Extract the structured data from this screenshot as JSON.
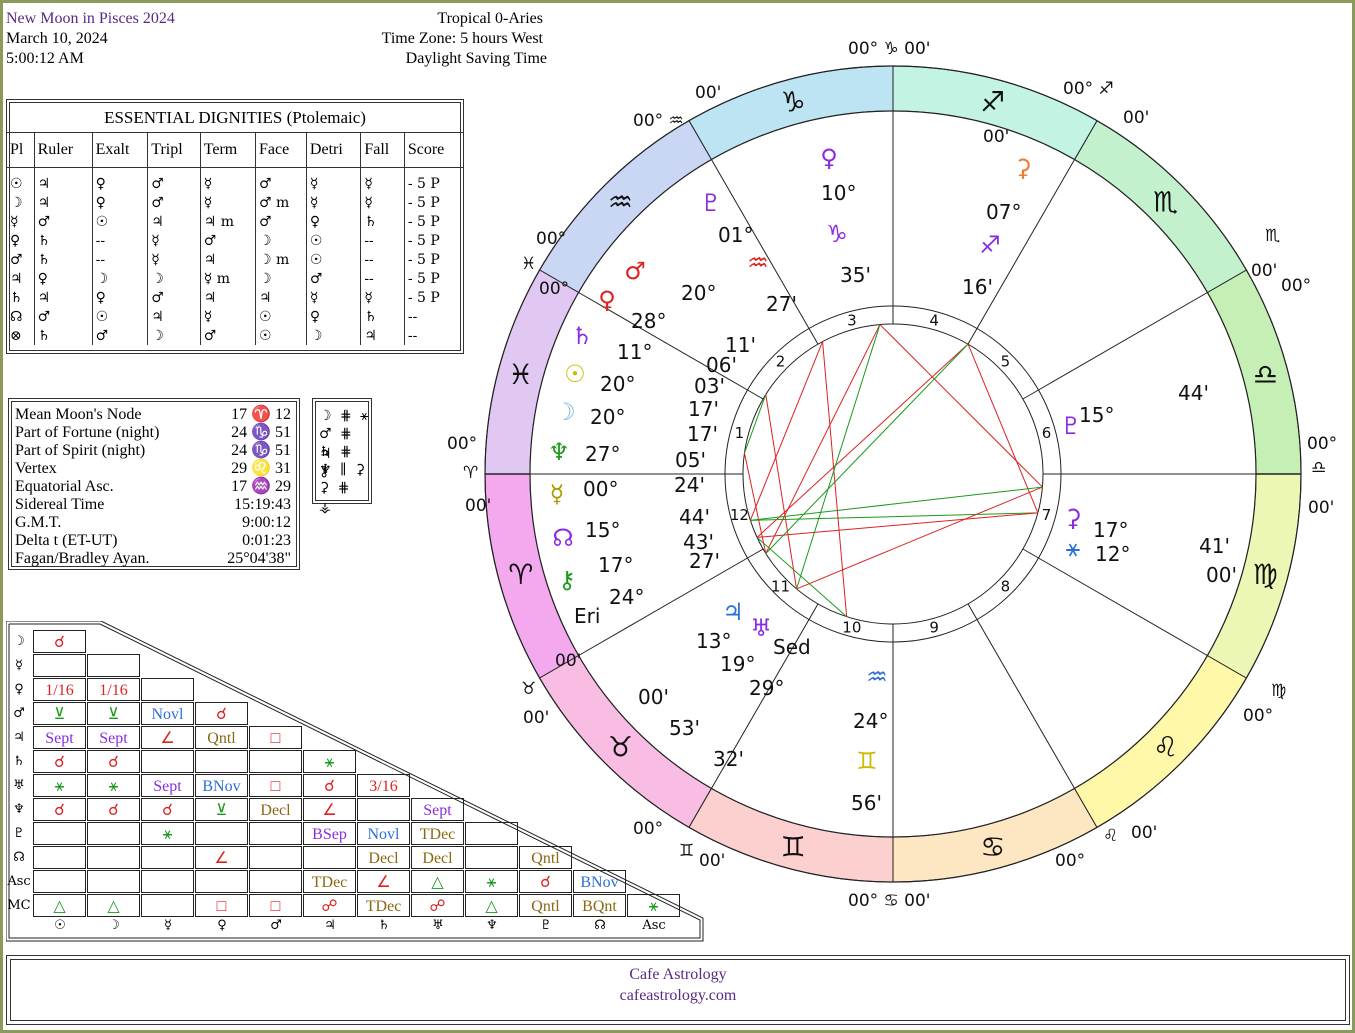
{
  "header": {
    "title": "New Moon in Pisces 2024",
    "date": "March 10, 2024",
    "time": "5:00:12 AM",
    "zodiac": "Tropical 0-Aries",
    "timezone": "Time Zone: 5 hours West",
    "dst": "Daylight Saving Time"
  },
  "dignities": {
    "caption": "ESSENTIAL DIGNITIES  (Ptolemaic)",
    "columns": [
      "Pl",
      "Ruler",
      "Exalt",
      "Tripl",
      "Term",
      "Face",
      "Detri",
      "Fall",
      "Score"
    ],
    "rows": [
      [
        "☉",
        "♃",
        "♀",
        "♂",
        "☿",
        "♂",
        "☿",
        "☿",
        "- 5 P"
      ],
      [
        "☽",
        "♃",
        "♀",
        "♂",
        "☿",
        "♂  m",
        "☿",
        "☿",
        "- 5 P"
      ],
      [
        "☿",
        "♂",
        "☉",
        "♃",
        "♃  m",
        "♂",
        "♀",
        "♄",
        "- 5 P"
      ],
      [
        "♀",
        "♄",
        "--",
        "☿",
        "♂",
        "☽",
        "☉",
        "--",
        "- 5 P"
      ],
      [
        "♂",
        "♄",
        "--",
        "☿",
        "♃",
        "☽  m",
        "☉",
        "--",
        "- 5 P"
      ],
      [
        "♃",
        "♀",
        "☽",
        "☽",
        "☿  m",
        "☽",
        "♂",
        "--",
        "- 5 P"
      ],
      [
        "♄",
        "♃",
        "♀",
        "♂",
        "♃",
        "♃",
        "☿",
        "☿",
        "- 5 P"
      ],
      [
        "☊",
        "♂",
        "☉",
        "♃",
        "☿",
        "☉",
        "♀",
        "♄",
        "--"
      ],
      [
        "⊗",
        "♄",
        "♂",
        "☽",
        "♂",
        "☉",
        "☽",
        "♃",
        "--"
      ]
    ]
  },
  "points": [
    {
      "label": "Mean Moon's Node",
      "value": "17 ♈ 12"
    },
    {
      "label": "Part of Fortune (night)",
      "value": "24 ♑ 51"
    },
    {
      "label": "Part of Spirit (night)",
      "value": "24 ♑ 51"
    },
    {
      "label": "Vertex",
      "value": "29 ♌ 31"
    },
    {
      "label": "Equatorial Asc.",
      "value": "17 ♒ 29"
    },
    {
      "label": "Sidereal Time",
      "value": "15:19:43"
    },
    {
      "label": "G.M.T.",
      "value": "9:00:12"
    },
    {
      "label": "Delta t (ET-UT)",
      "value": "0:01:23"
    },
    {
      "label": "Fagan/Bradley Ayan.",
      "value": "25°04'38\""
    }
  ],
  "mini_aspects": [
    "☽ ⋕ ⚹",
    "♂ ⋕ ♃",
    "♄ ⋕ ⚷",
    "♆ ∥ ⚳",
    "⚳ ⋕ ⚶"
  ],
  "aspect_grid": {
    "row_labels": [
      "☽",
      "☿",
      "♀",
      "♂",
      "♃",
      "♄",
      "♅",
      "♆",
      "♇",
      "☊",
      "Asc",
      "MC"
    ],
    "col_labels": [
      "☉",
      "☽",
      "☿",
      "♀",
      "♂",
      "♃",
      "♄",
      "♅",
      "♆",
      "♇",
      "☊",
      "Asc"
    ],
    "rows": [
      [
        {
          "t": "☌",
          "c": "#d22"
        }
      ],
      [
        {
          "t": "",
          "c": "#000"
        },
        {
          "t": "",
          "c": "#000"
        }
      ],
      [
        {
          "t": "1/16",
          "c": "#d22"
        },
        {
          "t": "1/16",
          "c": "#d22"
        },
        {
          "t": "",
          "c": "#000"
        }
      ],
      [
        {
          "t": "⊻",
          "c": "#1a9a1a"
        },
        {
          "t": "⊻",
          "c": "#1a9a1a"
        },
        {
          "t": "Novl",
          "c": "#2b6fd6"
        },
        {
          "t": "☌",
          "c": "#d22"
        }
      ],
      [
        {
          "t": "Sept",
          "c": "#8a2be2"
        },
        {
          "t": "Sept",
          "c": "#8a2be2"
        },
        {
          "t": "∠",
          "c": "#d22"
        },
        {
          "t": "Qntl",
          "c": "#8b6914"
        },
        {
          "t": "□",
          "c": "#d22"
        }
      ],
      [
        {
          "t": "☌",
          "c": "#d22"
        },
        {
          "t": "☌",
          "c": "#d22"
        },
        {
          "t": "",
          "c": "#000"
        },
        {
          "t": "",
          "c": "#000"
        },
        {
          "t": "",
          "c": "#000"
        },
        {
          "t": "⚹",
          "c": "#1a9a1a"
        }
      ],
      [
        {
          "t": "⚹",
          "c": "#1a9a1a"
        },
        {
          "t": "⚹",
          "c": "#1a9a1a"
        },
        {
          "t": "Sept",
          "c": "#8a2be2"
        },
        {
          "t": "BNov",
          "c": "#2b6fd6"
        },
        {
          "t": "□",
          "c": "#d22"
        },
        {
          "t": "☌",
          "c": "#d22"
        },
        {
          "t": "3/16",
          "c": "#d22"
        }
      ],
      [
        {
          "t": "☌",
          "c": "#d22"
        },
        {
          "t": "☌",
          "c": "#d22"
        },
        {
          "t": "☌",
          "c": "#d22"
        },
        {
          "t": "⊻",
          "c": "#1a9a1a"
        },
        {
          "t": "Decl",
          "c": "#8b6914"
        },
        {
          "t": "∠",
          "c": "#d22"
        },
        {
          "t": "",
          "c": "#000"
        },
        {
          "t": "Sept",
          "c": "#8a2be2"
        }
      ],
      [
        {
          "t": "",
          "c": "#000"
        },
        {
          "t": "",
          "c": "#000"
        },
        {
          "t": "⚹",
          "c": "#1a9a1a"
        },
        {
          "t": "",
          "c": "#000"
        },
        {
          "t": "",
          "c": "#000"
        },
        {
          "t": "BSep",
          "c": "#8a2be2"
        },
        {
          "t": "Novl",
          "c": "#2b6fd6"
        },
        {
          "t": "TDec",
          "c": "#8b6914"
        },
        {
          "t": "",
          "c": "#000"
        }
      ],
      [
        {
          "t": "",
          "c": "#000"
        },
        {
          "t": "",
          "c": "#000"
        },
        {
          "t": "",
          "c": "#000"
        },
        {
          "t": "∠",
          "c": "#d22"
        },
        {
          "t": "",
          "c": "#000"
        },
        {
          "t": "",
          "c": "#000"
        },
        {
          "t": "Decl",
          "c": "#8b6914"
        },
        {
          "t": "Decl",
          "c": "#8b6914"
        },
        {
          "t": "",
          "c": "#000"
        },
        {
          "t": "Qntl",
          "c": "#8b6914"
        }
      ],
      [
        {
          "t": "",
          "c": "#000"
        },
        {
          "t": "",
          "c": "#000"
        },
        {
          "t": "",
          "c": "#000"
        },
        {
          "t": "",
          "c": "#000"
        },
        {
          "t": "",
          "c": "#000"
        },
        {
          "t": "TDec",
          "c": "#8b6914"
        },
        {
          "t": "∠",
          "c": "#d22"
        },
        {
          "t": "△",
          "c": "#1a9a1a"
        },
        {
          "t": "⚹",
          "c": "#1a9a1a"
        },
        {
          "t": "☌",
          "c": "#d22"
        },
        {
          "t": "BNov",
          "c": "#2b6fd6"
        }
      ],
      [
        {
          "t": "△",
          "c": "#1a9a1a"
        },
        {
          "t": "△",
          "c": "#1a9a1a"
        },
        {
          "t": "",
          "c": "#000"
        },
        {
          "t": "□",
          "c": "#d22"
        },
        {
          "t": "□",
          "c": "#d22"
        },
        {
          "t": "☍",
          "c": "#d22"
        },
        {
          "t": "TDec",
          "c": "#8b6914"
        },
        {
          "t": "☍",
          "c": "#d22"
        },
        {
          "t": "△",
          "c": "#1a9a1a"
        },
        {
          "t": "Qntl",
          "c": "#8b6914"
        },
        {
          "t": "BQnt",
          "c": "#8b6914"
        },
        {
          "t": "⚹",
          "c": "#1a9a1a"
        }
      ]
    ]
  },
  "wheel": {
    "cusp_labels": [
      {
        "t": "00° ♑ 00'"
      },
      {
        "t": "00'"
      },
      {
        "t": "00° ♒"
      },
      {
        "t": "00° ♐"
      },
      {
        "t": "00'"
      },
      {
        "t": "00'"
      },
      {
        "t": "♓"
      },
      {
        "t": "00°"
      },
      {
        "t": "00° "
      },
      {
        "t": "♏"
      },
      {
        "t": "00'"
      },
      {
        "t": "00°"
      },
      {
        "t": "♈"
      },
      {
        "t": "00'"
      },
      {
        "t": "00°"
      },
      {
        "t": "♎"
      },
      {
        "t": "00'"
      },
      {
        "t": "00°"
      },
      {
        "t": "♉"
      },
      {
        "t": "00'"
      },
      {
        "t": "00'"
      },
      {
        "t": "♍"
      },
      {
        "t": "00°"
      },
      {
        "t": "00°"
      },
      {
        "t": "♊"
      },
      {
        "t": "00'"
      },
      {
        "t": "00° ♋ 00'"
      },
      {
        "t": "00°"
      },
      {
        "t": "♌"
      },
      {
        "t": "00'"
      }
    ],
    "planet_labels": [
      {
        "t": "10°"
      },
      {
        "t": "35'"
      },
      {
        "t": "01°"
      },
      {
        "t": "27'"
      },
      {
        "t": "07°"
      },
      {
        "t": "16'"
      },
      {
        "t": "20°"
      },
      {
        "t": "28°"
      },
      {
        "t": "11'"
      },
      {
        "t": "06'"
      },
      {
        "t": "11°"
      },
      {
        "t": "03'"
      },
      {
        "t": "20°"
      },
      {
        "t": "17'"
      },
      {
        "t": "20°"
      },
      {
        "t": "17'"
      },
      {
        "t": "27°"
      },
      {
        "t": "05'"
      },
      {
        "t": "00°"
      },
      {
        "t": "24'"
      },
      {
        "t": "15°"
      },
      {
        "t": "44'"
      },
      {
        "t": "17°"
      },
      {
        "t": "43'"
      },
      {
        "t": "24°"
      },
      {
        "t": "27'"
      },
      {
        "t": "15°"
      },
      {
        "t": "44'"
      },
      {
        "t": "17°"
      },
      {
        "t": "12°"
      },
      {
        "t": "41'"
      },
      {
        "t": "00'"
      },
      {
        "t": "13°"
      },
      {
        "t": "19°"
      },
      {
        "t": "29°"
      },
      {
        "t": "00'"
      },
      {
        "t": "53'"
      },
      {
        "t": "32'"
      },
      {
        "t": "24°"
      },
      {
        "t": "56'"
      },
      {
        "t": "Eri"
      },
      {
        "t": "Sed"
      }
    ],
    "house_numbers": [
      "1",
      "2",
      "3",
      "4",
      "5",
      "6",
      "7",
      "8",
      "9",
      "10",
      "11",
      "12"
    ]
  },
  "footer": {
    "line1": "Cafe Astrology",
    "line2": "cafeastrology.com"
  }
}
